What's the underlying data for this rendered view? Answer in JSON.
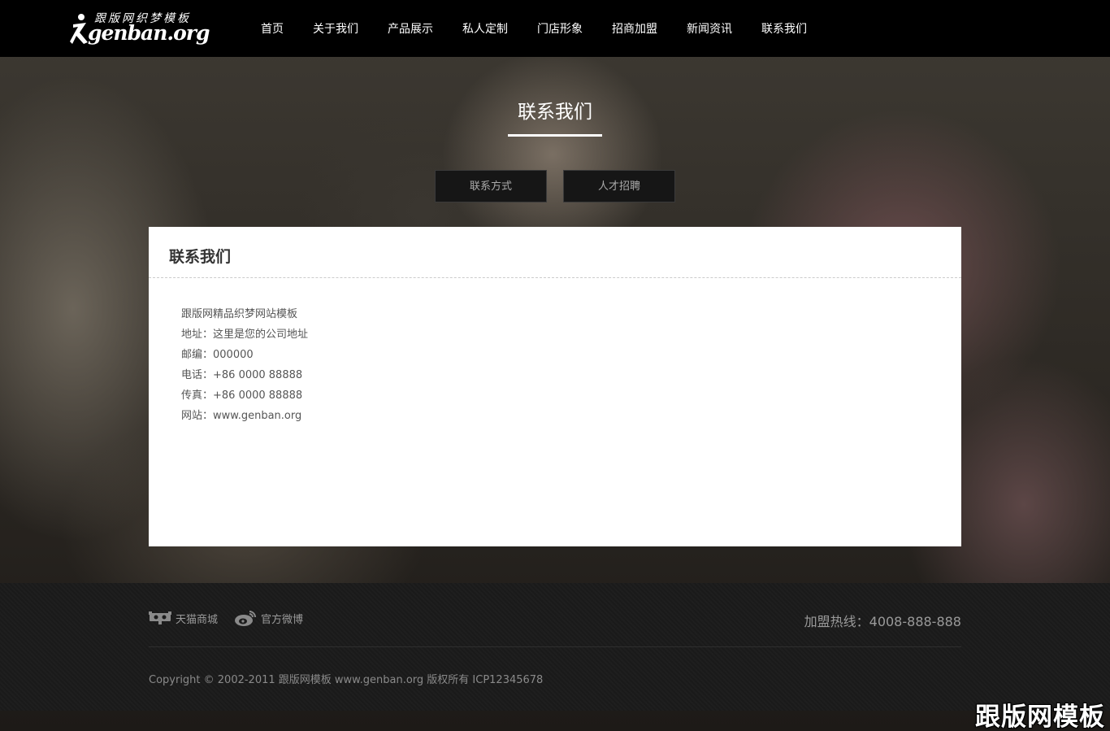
{
  "logo": {
    "text_cn": "跟版网织梦模板",
    "text_en": "genban.org"
  },
  "nav": {
    "items": [
      {
        "label": "首页"
      },
      {
        "label": "关于我们"
      },
      {
        "label": "产品展示"
      },
      {
        "label": "私人定制"
      },
      {
        "label": "门店形象"
      },
      {
        "label": "招商加盟"
      },
      {
        "label": "新闻资讯"
      },
      {
        "label": "联系我们"
      }
    ]
  },
  "page": {
    "title": "联系我们"
  },
  "subtabs": [
    {
      "label": "联系方式"
    },
    {
      "label": "人才招聘"
    }
  ],
  "card": {
    "title": "联系我们",
    "lines": [
      "跟版网精品织梦网站模板",
      "地址：这里是您的公司地址",
      "邮编：000000",
      "电话：+86 0000 88888",
      "传真：+86 0000 88888",
      "网站：www.genban.org"
    ]
  },
  "footer": {
    "links": [
      {
        "label": "天猫商城",
        "icon": "tmall-icon"
      },
      {
        "label": "官方微博",
        "icon": "weibo-icon"
      }
    ],
    "hotline": "加盟热线：4008-888-888",
    "copyright": "Copyright © 2002-2011 跟版网模板 www.genban.org 版权所有   ICP12345678"
  },
  "watermark": "跟版网模板"
}
